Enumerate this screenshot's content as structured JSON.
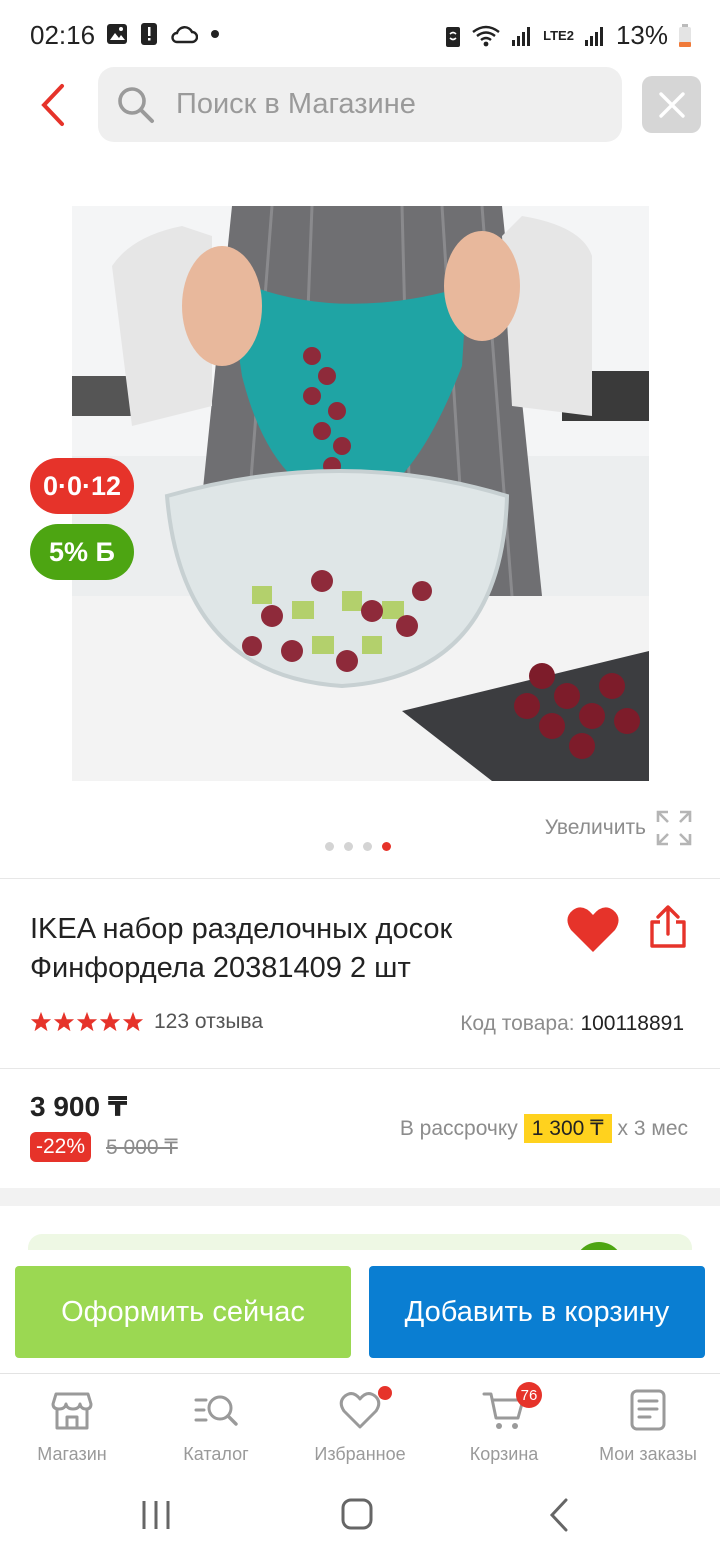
{
  "status_bar": {
    "time": "02:16",
    "network": "LTE2",
    "battery": "13%",
    "icons": [
      "gallery-icon",
      "alert-icon",
      "cloud-icon",
      "dot-icon",
      "nfc-icon",
      "wifi-icon",
      "signal-icon",
      "battery-icon"
    ]
  },
  "header": {
    "search_placeholder": "Поиск в Магазине",
    "icons": [
      "back-arrow-icon",
      "search-icon",
      "close-icon"
    ]
  },
  "product": {
    "timer_badge": "0·0·12",
    "bonus_badge": "5% Б",
    "zoom_label": "Увеличить",
    "gallery_count": 4,
    "gallery_active_index": 3,
    "title": "IKEA набор разделочных досок Финфордела 20381409 2 шт",
    "rating_stars": 5,
    "reviews": "123 отзыва",
    "sku_label": "Код товара:",
    "sku_value": "100118891",
    "price": "3 900 ₸",
    "discount": "-22%",
    "old_price": "5 000 ₸",
    "installment_prefix": "В рассрочку",
    "installment_amount": "1 300 ₸",
    "installment_suffix": "х 3 мес"
  },
  "actions": {
    "checkout_label": "Оформить сейчас",
    "add_to_cart_label": "Добавить в корзину"
  },
  "bottom_nav": {
    "items": [
      {
        "label": "Магазин",
        "icon": "store-icon"
      },
      {
        "label": "Каталог",
        "icon": "catalog-search-icon"
      },
      {
        "label": "Избранное",
        "icon": "heart-outline-icon"
      },
      {
        "label": "Корзина",
        "icon": "cart-icon",
        "badge": "76"
      },
      {
        "label": "Мои заказы",
        "icon": "orders-icon"
      }
    ]
  },
  "colors": {
    "accent_red": "#e6332a",
    "checkout_green": "#9bd852",
    "cart_blue": "#0a7ed2",
    "bonus_green": "#4da512",
    "installment_yellow": "#ffd21e"
  }
}
